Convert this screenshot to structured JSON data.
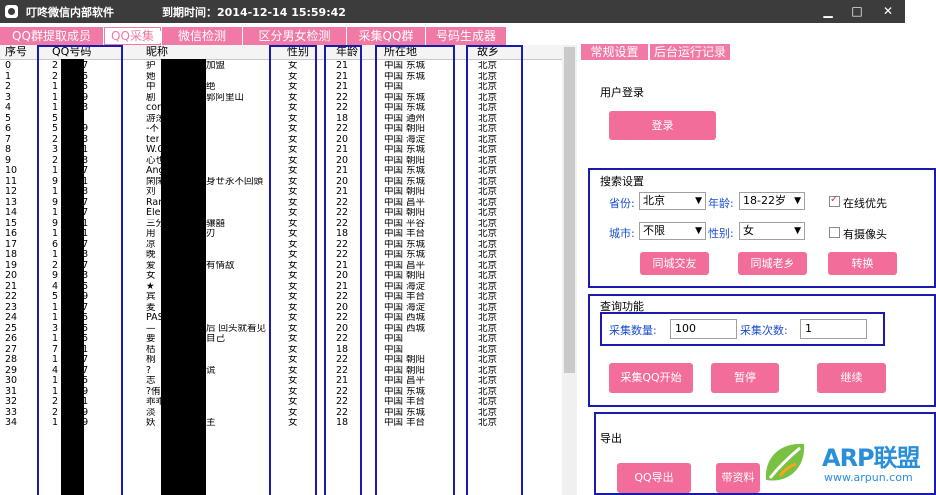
{
  "window": {
    "title": "叮咚微信内部软件",
    "expiry_label": "到期时间：2014-12-14 15:59:42",
    "min_symbol": "▁",
    "max_symbol": "□",
    "close_symbol": "✕"
  },
  "tabs": [
    "QQ群提取成员",
    "QQ采集",
    "微信检测",
    "区分男女检测",
    "采集QQ群",
    "号码生成器"
  ],
  "active_tab": 1,
  "table": {
    "headers": [
      "序号",
      "QQ号码",
      "昵称",
      "性别",
      "年龄",
      "所在地",
      "故乡"
    ],
    "rows": [
      [
        "0",
        "2",
        "987",
        "护",
        "加盟",
        "女",
        "21",
        "中国 东城",
        "北京"
      ],
      [
        "1",
        "2",
        "715",
        "她",
        "",
        "女",
        "21",
        "中国 东城",
        "北京"
      ],
      [
        "2",
        "1",
        "595",
        "中",
        "绝",
        "女",
        "21",
        "中国",
        "北京"
      ],
      [
        "3",
        "1",
        "539",
        "剧",
        "郭阿里山",
        "女",
        "22",
        "中国 东城",
        "北京"
      ],
      [
        "4",
        "1",
        "043",
        "cor",
        "",
        "女",
        "22",
        "中国 东城",
        "北京"
      ],
      [
        "5",
        "5",
        "79",
        "游荡",
        "",
        "女",
        "18",
        "中国 通州",
        "北京"
      ],
      [
        "6",
        "5",
        "499",
        "-不",
        "",
        "女",
        "22",
        "中国 朝阳",
        "北京"
      ],
      [
        "7",
        "2",
        "763",
        "ter",
        "",
        "女",
        "20",
        "中国 海淀",
        "北京"
      ],
      [
        "8",
        "3",
        "651",
        "W.Q",
        "",
        "女",
        "21",
        "中国 东城",
        "北京"
      ],
      [
        "9",
        "2",
        "163",
        "心也",
        "",
        "女",
        "20",
        "中国 朝阳",
        "北京"
      ],
      [
        "10",
        "1",
        "427",
        "Ang",
        "",
        "女",
        "21",
        "中国 东城",
        "北京"
      ],
      [
        "11",
        "9",
        "851",
        "閑閑",
        "身ㄝ永不回頭",
        "女",
        "20",
        "中国 东城",
        "北京"
      ],
      [
        "12",
        "1",
        "163",
        "刘",
        "",
        "女",
        "21",
        "中国 朝阳",
        "北京"
      ],
      [
        "13",
        "9",
        "987",
        "Ran",
        "",
        "女",
        "22",
        "中国 昌平",
        "北京"
      ],
      [
        "14",
        "1",
        "187",
        "Ele",
        "",
        "女",
        "22",
        "中国 朝阳",
        "北京"
      ],
      [
        "15",
        "9",
        "171",
        "三分",
        "骧囍",
        "女",
        "22",
        "中国 平谷",
        "北京"
      ],
      [
        "16",
        "1",
        "251",
        "用",
        "刃",
        "女",
        "18",
        "中国 丰台",
        "北京"
      ],
      [
        "17",
        "6",
        "267",
        "凉",
        "",
        "女",
        "22",
        "中国 东城",
        "北京"
      ],
      [
        "18",
        "1",
        "263",
        "晚",
        "",
        "女",
        "22",
        "中国 东城",
        "北京"
      ],
      [
        "19",
        "2",
        "227",
        "爱",
        "有情敌",
        "女",
        "21",
        "中国 昌平",
        "北京"
      ],
      [
        "20",
        "9",
        "043",
        "女",
        "",
        "女",
        "20",
        "中国 朝阳",
        "北京"
      ],
      [
        "21",
        "4",
        "155",
        "★",
        "",
        "女",
        "21",
        "中国 海淀",
        "北京"
      ],
      [
        "22",
        "5",
        "019",
        "宾",
        "",
        "女",
        "22",
        "中国 丰台",
        "北京"
      ],
      [
        "23",
        "1",
        "227",
        "麦",
        "",
        "女",
        "20",
        "中国 海淀",
        "北京"
      ],
      [
        "24",
        "1",
        "035",
        "PAS",
        "",
        "女",
        "22",
        "中国 西城",
        "北京"
      ],
      [
        "25",
        "3",
        "295",
        "—",
        "后 回头就看见",
        "女",
        "20",
        "中国 西城",
        "北京"
      ],
      [
        "26",
        "1",
        "895",
        "要",
        "自己",
        "女",
        "22",
        "中国",
        "北京"
      ],
      [
        "27",
        "7",
        "751",
        "枯",
        "",
        "女",
        "18",
        "中国",
        "北京"
      ],
      [
        "28",
        "1",
        "247",
        "桐",
        "",
        "女",
        "22",
        "中国 朝阳",
        "北京"
      ],
      [
        "29",
        "4",
        "687",
        "?",
        "谎",
        "女",
        "22",
        "中国 朝阳",
        "北京"
      ],
      [
        "30",
        "1",
        "255",
        "志",
        "",
        "女",
        "21",
        "中国 昌平",
        "北京"
      ],
      [
        "31",
        "1",
        "439",
        "?侑",
        "",
        "女",
        "22",
        "中国 东城",
        "北京"
      ],
      [
        "32",
        "2",
        "271",
        "乖乖",
        "",
        "女",
        "22",
        "中国 丰台",
        "北京"
      ],
      [
        "33",
        "2",
        "759",
        "淡",
        "",
        "女",
        "22",
        "中国 东城",
        "北京"
      ],
      [
        "34",
        "1",
        "839",
        "妖",
        "主",
        "女",
        "18",
        "中国 丰台",
        "北京"
      ]
    ]
  },
  "panel": {
    "tabs": [
      "常规设置",
      "后台运行记录"
    ],
    "login": {
      "title": "用户登录",
      "button": "登录"
    },
    "search": {
      "title": "搜索设置",
      "province_label": "省份:",
      "province_value": "北京",
      "age_label": "年龄:",
      "age_value": "18-22岁",
      "online_label": "在线优先",
      "online_checked": true,
      "city_label": "城市:",
      "city_value": "不限",
      "gender_label": "性别:",
      "gender_value": "女",
      "camera_label": "有摄像头",
      "camera_checked": false,
      "btn_same_city": "同城交友",
      "btn_hometown": "同城老乡",
      "btn_switch": "转换"
    },
    "query": {
      "title": "查询功能",
      "count_label": "采集数量:",
      "count_value": "100",
      "times_label": "采集次数:",
      "times_value": "1",
      "btn_start": "采集QQ开始",
      "btn_pause": "暂停",
      "btn_continue": "继续"
    },
    "export": {
      "title": "导出",
      "btn_export": "QQ导出",
      "btn_with_data": "带资料"
    }
  },
  "watermark": {
    "brand": "ARP联盟",
    "url": "www.arpun.com"
  }
}
